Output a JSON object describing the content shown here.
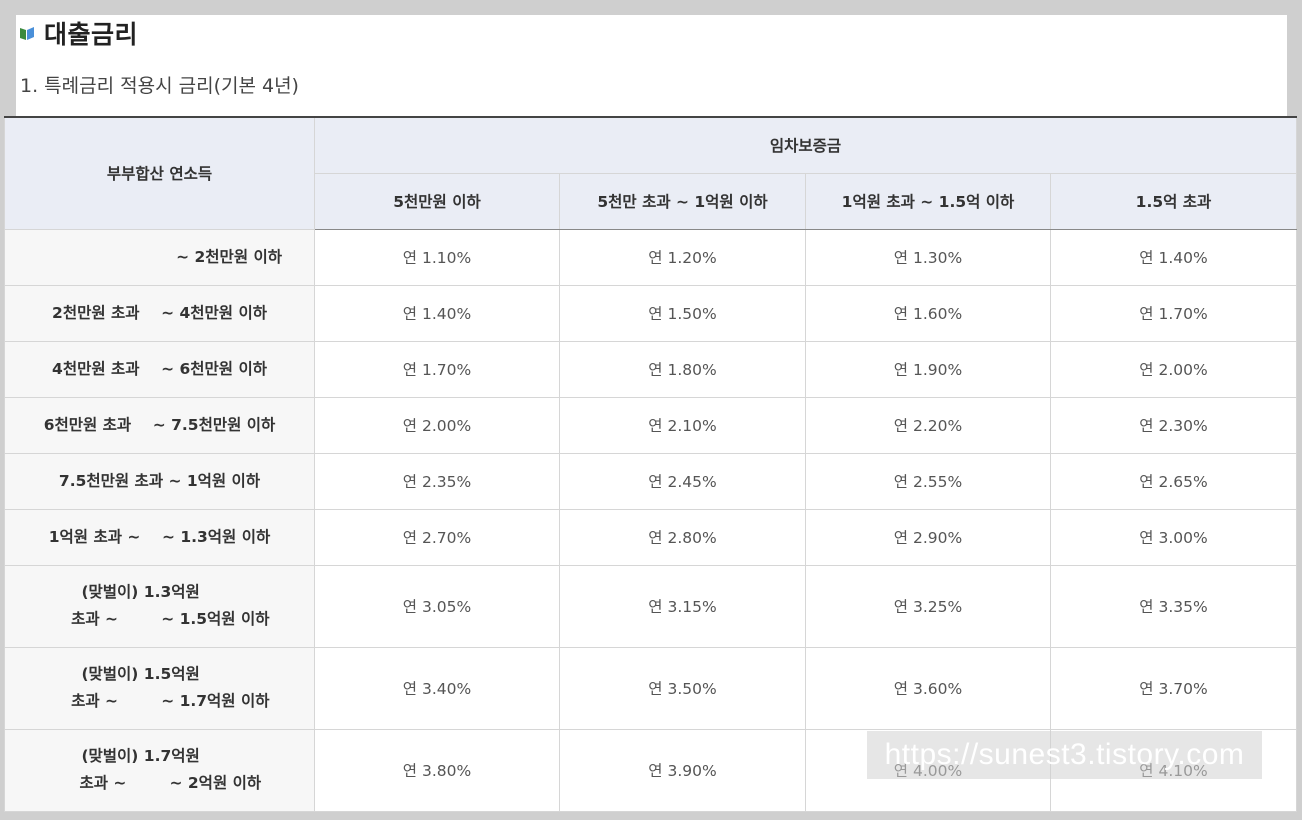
{
  "heading": {
    "title": "대출금리",
    "icon": "book-icon"
  },
  "subtitle": "1. 특례금리 적용시 금리(기본 4년)",
  "table": {
    "row_header_title": "부부합산 연소득",
    "group_header": "임차보증금",
    "columns": [
      "5천만원 이하",
      "5천만 초과 ~ 1억원 이하",
      "1억원 초과 ~ 1.5억 이하",
      "1.5억 초과"
    ],
    "rows": [
      {
        "label": "~ 2천만원 이하",
        "values": [
          "연 1.10%",
          "연 1.20%",
          "연 1.30%",
          "연 1.40%"
        ]
      },
      {
        "label": "2천만원 초과    ~ 4천만원 이하",
        "values": [
          "연 1.40%",
          "연 1.50%",
          "연 1.60%",
          "연 1.70%"
        ]
      },
      {
        "label": "4천만원 초과    ~ 6천만원 이하",
        "values": [
          "연 1.70%",
          "연 1.80%",
          "연 1.90%",
          "연 2.00%"
        ]
      },
      {
        "label": "6천만원 초과    ~ 7.5천만원 이하",
        "values": [
          "연 2.00%",
          "연 2.10%",
          "연 2.20%",
          "연 2.30%"
        ]
      },
      {
        "label": "7.5천만원 초과 ~ 1억원 이하",
        "values": [
          "연 2.35%",
          "연 2.45%",
          "연 2.55%",
          "연 2.65%"
        ]
      },
      {
        "label": "1억원 초과 ~    ~ 1.3억원 이하",
        "values": [
          "연 2.70%",
          "연 2.80%",
          "연 2.90%",
          "연 3.00%"
        ]
      },
      {
        "label": "(맞벌이) 1.3억원       \n    초과 ~        ~ 1.5억원 이하",
        "values": [
          "연 3.05%",
          "연 3.15%",
          "연 3.25%",
          "연 3.35%"
        ]
      },
      {
        "label": "(맞벌이) 1.5억원       \n    초과 ~        ~ 1.7억원 이하",
        "values": [
          "연 3.40%",
          "연 3.50%",
          "연 3.60%",
          "연 3.70%"
        ]
      },
      {
        "label": "(맞벌이) 1.7억원       \n    초과 ~        ~ 2억원 이하",
        "values": [
          "연 3.80%",
          "연 3.90%",
          "연 4.00%",
          "연 4.10%"
        ]
      }
    ]
  },
  "watermark": "https://sunest3.tistory.com"
}
